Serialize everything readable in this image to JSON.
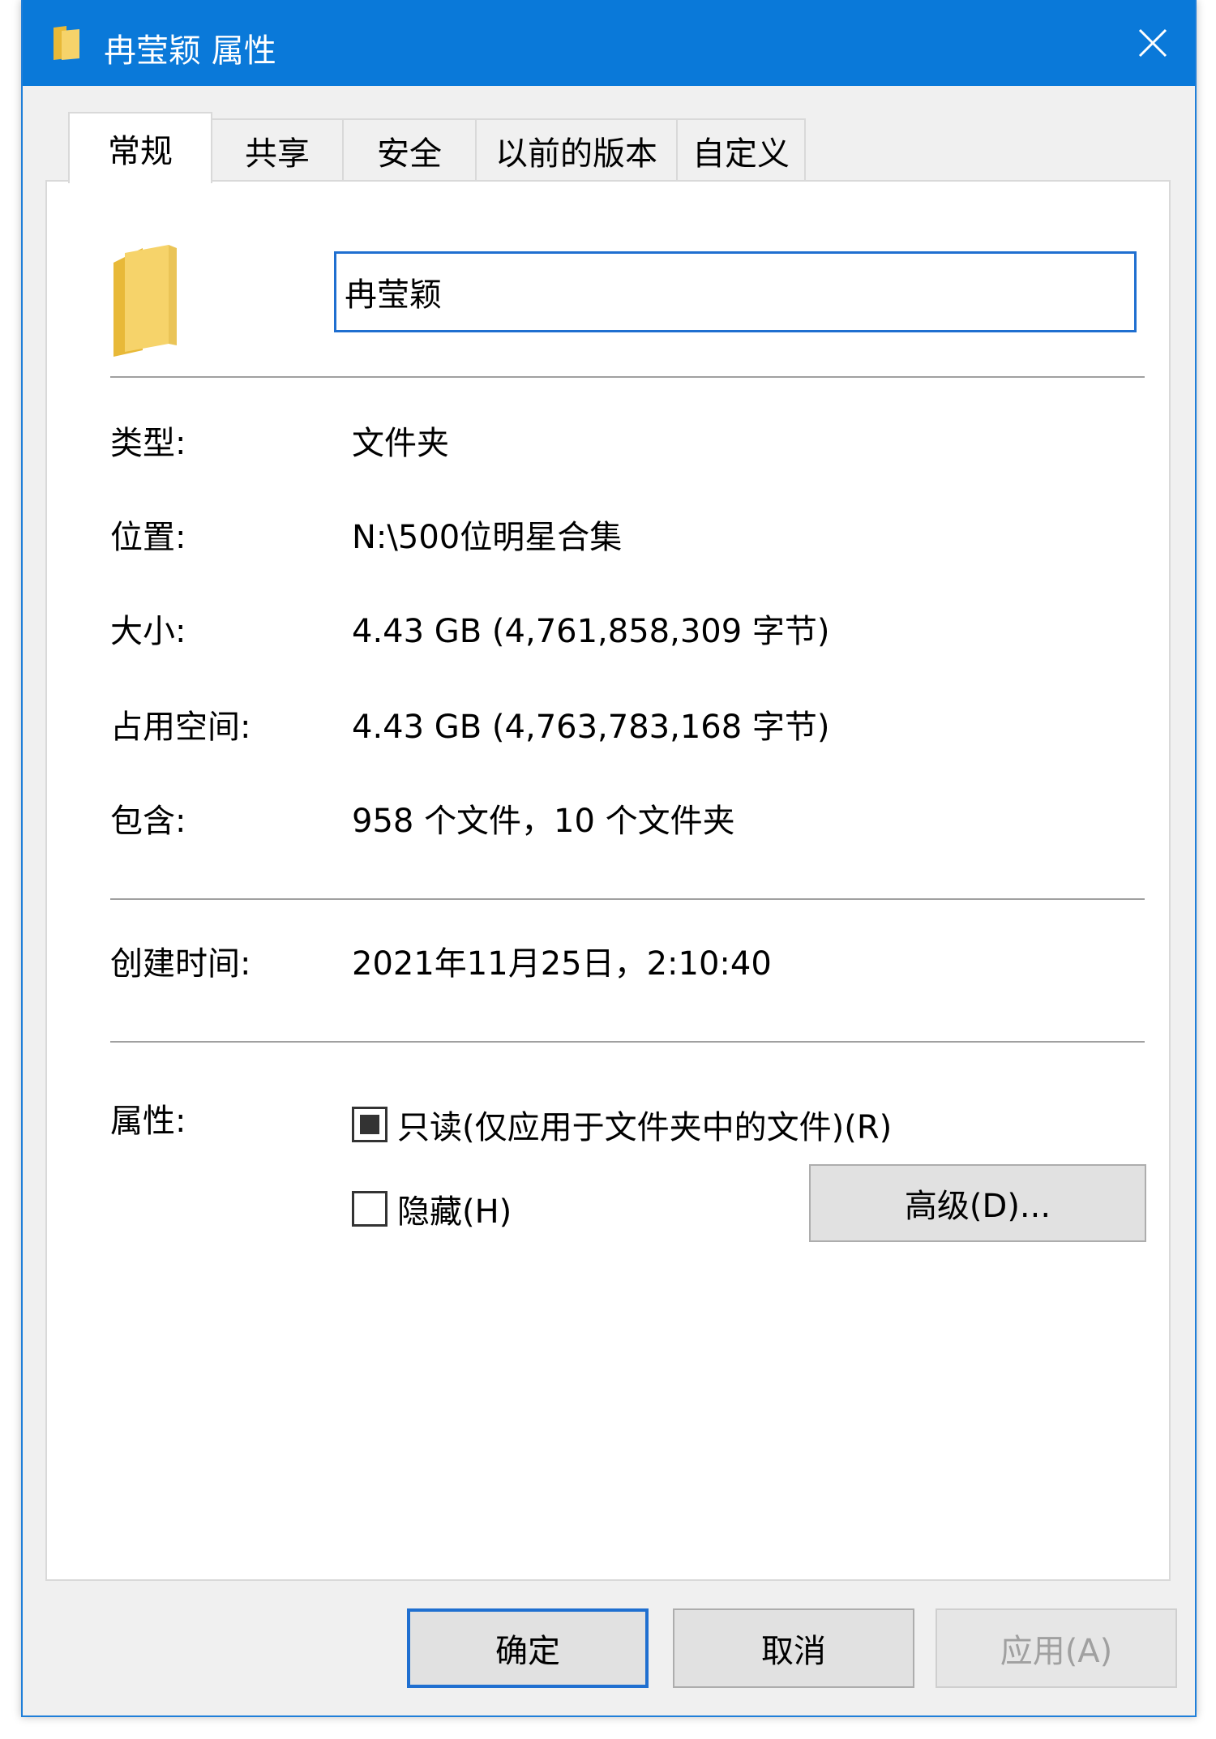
{
  "window": {
    "title": "冉莹颖 属性",
    "title_icon": "folder-icon",
    "close_icon": "close-icon"
  },
  "tabs": [
    {
      "label": "常规",
      "active": true
    },
    {
      "label": "共享",
      "active": false
    },
    {
      "label": "安全",
      "active": false
    },
    {
      "label": "以前的版本",
      "active": false
    },
    {
      "label": "自定义",
      "active": false
    }
  ],
  "general": {
    "folder_icon": "folder-icon",
    "name_value": "冉莹颖",
    "properties": [
      {
        "label": "类型:",
        "value": "文件夹"
      },
      {
        "label": "位置:",
        "value": "N:\\500位明星合集"
      },
      {
        "label": "大小:",
        "value": "4.43 GB (4,761,858,309 字节)"
      },
      {
        "label": "占用空间:",
        "value": "4.43 GB (4,763,783,168 字节)"
      },
      {
        "label": "包含:",
        "value": "958 个文件，10 个文件夹"
      }
    ],
    "created": {
      "label": "创建时间:",
      "value": "2021年11月25日，2:10:40"
    },
    "attributes": {
      "label": "属性:",
      "readonly_label": "只读(仅应用于文件夹中的文件)(R)",
      "readonly_state": "indeterminate",
      "hidden_label": "隐藏(H)",
      "hidden_state": "unchecked",
      "advanced_label": "高级(D)..."
    }
  },
  "footer": {
    "ok_label": "确定",
    "cancel_label": "取消",
    "apply_label": "应用(A)"
  },
  "colors": {
    "titlebar": "#0a79d9",
    "focus_border": "#1f6fd0",
    "folder_yellow": "#f3c95a"
  }
}
